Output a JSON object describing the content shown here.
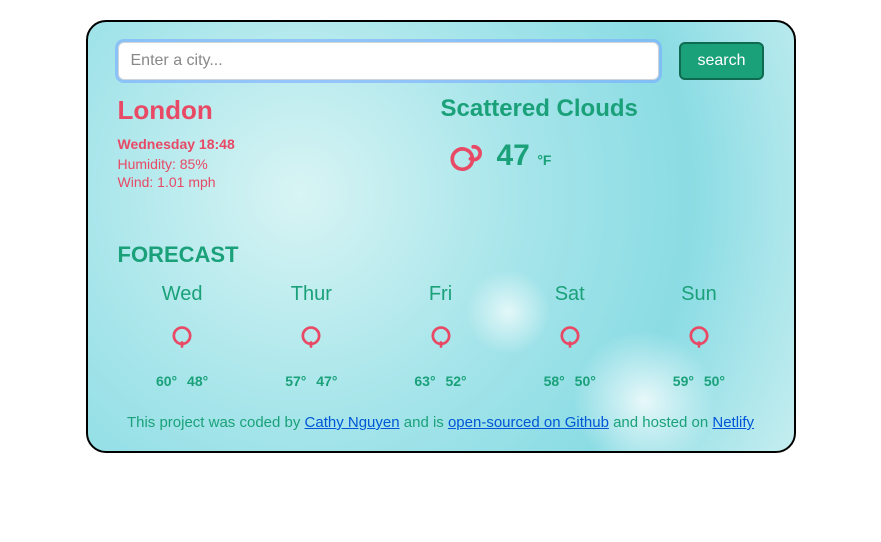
{
  "search": {
    "placeholder": "Enter a city...",
    "button_label": "search"
  },
  "current": {
    "city": "London",
    "datetime": "Wednesday 18:48",
    "humidity_label": "Humidity: 85%",
    "wind_label": "Wind: 1.01 mph",
    "condition": "Scattered Clouds",
    "temp": "47",
    "unit": "°F"
  },
  "forecast_heading": "FORECAST",
  "forecast": [
    {
      "day": "Wed",
      "high": "60°",
      "low": "48°"
    },
    {
      "day": "Thur",
      "high": "57°",
      "low": "47°"
    },
    {
      "day": "Fri",
      "high": "63°",
      "low": "52°"
    },
    {
      "day": "Sat",
      "high": "58°",
      "low": "50°"
    },
    {
      "day": "Sun",
      "high": "59°",
      "low": "50°"
    }
  ],
  "footer": {
    "t1": "This project was coded by ",
    "author": "Cathy Nguyen",
    "t2": " and is ",
    "source": "open-sourced on Github",
    "t3": " and hosted on ",
    "host": "Netlify"
  }
}
